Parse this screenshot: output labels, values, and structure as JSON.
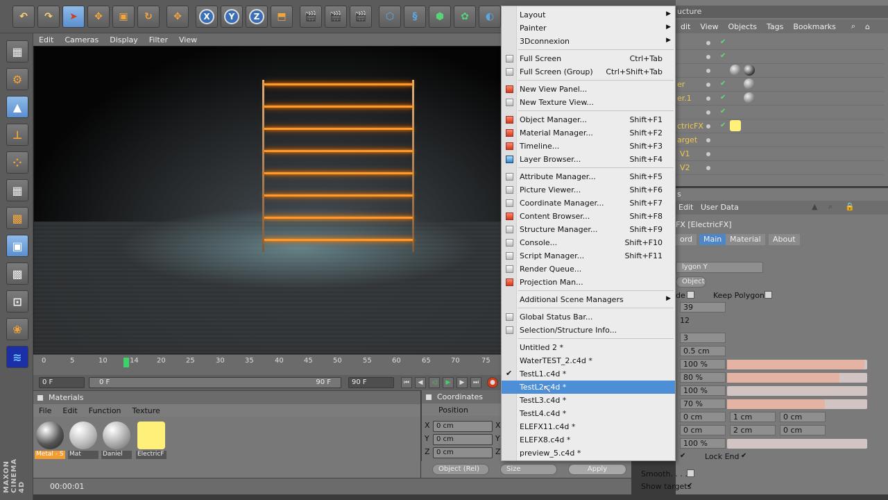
{
  "toolbar": {
    "axis_x": "X",
    "axis_y": "Y",
    "axis_z": "Z"
  },
  "viewport": {
    "menu": [
      "Edit",
      "Cameras",
      "Display",
      "Filter",
      "View"
    ]
  },
  "timeline": {
    "ticks": [
      "0",
      "5",
      "10",
      "14",
      "20",
      "25",
      "30",
      "35",
      "40",
      "45",
      "50",
      "55",
      "60",
      "65",
      "70",
      "75"
    ],
    "start_field": "0 F",
    "range_start": "0 F",
    "range_end": "90 F",
    "end_field": "90 F"
  },
  "materials": {
    "title": "Materials",
    "menu": [
      "File",
      "Edit",
      "Function",
      "Texture"
    ],
    "items": [
      "Metal - S",
      "Mat",
      "Daniel",
      "ElectricF"
    ]
  },
  "coordinates": {
    "title": "Coordinates",
    "position_label": "Position",
    "rows": [
      {
        "axis": "X",
        "value": "0 cm",
        "axis2": "X"
      },
      {
        "axis": "Y",
        "value": "0 cm",
        "axis2": "Y"
      },
      {
        "axis": "Z",
        "value": "0 cm",
        "axis2": "Z"
      }
    ],
    "mode_dropdown": "Object (Rel)",
    "size_dropdown": "Size",
    "apply_label": "Apply"
  },
  "status": {
    "time": "00:00:01"
  },
  "object_manager": {
    "tab_label": "ucture",
    "menu": [
      "dit",
      "View",
      "Objects",
      "Tags",
      "Bookmarks"
    ],
    "rows": [
      {
        "name": ""
      },
      {
        "name": ""
      },
      {
        "name": ""
      },
      {
        "name": "er"
      },
      {
        "name": "er.1"
      },
      {
        "name": ""
      },
      {
        "name": "ctricFX"
      },
      {
        "name": "arget"
      },
      {
        "name": "V1"
      },
      {
        "name": "V2"
      }
    ]
  },
  "attribute_manager": {
    "header_fragment": "s",
    "menu": [
      "Edit",
      "User Data"
    ],
    "object_title": "FX [ElectricFX]",
    "tabs": [
      "ord",
      "Main",
      "Material",
      "About"
    ],
    "dropdown1": "lygon Y",
    "button1": "Object",
    "mode_fragment": "de",
    "keep_polygon_label": "Keep Polygon",
    "value_39": "39",
    "value_12": "12",
    "value_3": "3",
    "value_05cm": "0.5 cm",
    "pct_rows": [
      {
        "value": "100 %",
        "fill": 1.0
      },
      {
        "value": "80 %",
        "fill": 0.8
      },
      {
        "value": "100 %",
        "fill": 0.0
      },
      {
        "value": "70 %",
        "fill": 0.7
      }
    ],
    "vec_row1": [
      "0 cm",
      "1 cm",
      "0 cm"
    ],
    "vec_row2": [
      "0 cm",
      "2 cm",
      "0 cm"
    ],
    "pct_last": "100 %",
    "lock_end_label": "Lock End",
    "smooth_label": "Smooth. . . . .",
    "show_targets_label": "Show targets"
  },
  "window_menu": {
    "items": [
      {
        "label": "Layout",
        "shortcut": "",
        "submenu": true
      },
      {
        "label": "Painter",
        "shortcut": "",
        "submenu": true
      },
      {
        "label": "3Dconnexion",
        "shortcut": "",
        "submenu": true
      },
      {
        "label": "Full Screen",
        "shortcut": "Ctrl+Tab"
      },
      {
        "label": "Full Screen (Group)",
        "shortcut": "Ctrl+Shift+Tab"
      },
      {
        "label": "New View Panel...",
        "shortcut": ""
      },
      {
        "label": "New Texture View...",
        "shortcut": ""
      },
      {
        "label": "Object Manager...",
        "shortcut": "Shift+F1"
      },
      {
        "label": "Material Manager...",
        "shortcut": "Shift+F2"
      },
      {
        "label": "Timeline...",
        "shortcut": "Shift+F3"
      },
      {
        "label": "Layer Browser...",
        "shortcut": "Shift+F4"
      },
      {
        "label": "Attribute Manager...",
        "shortcut": "Shift+F5"
      },
      {
        "label": "Picture Viewer...",
        "shortcut": "Shift+F6"
      },
      {
        "label": "Coordinate Manager...",
        "shortcut": "Shift+F7"
      },
      {
        "label": "Content Browser...",
        "shortcut": "Shift+F8"
      },
      {
        "label": "Structure Manager...",
        "shortcut": "Shift+F9"
      },
      {
        "label": "Console...",
        "shortcut": "Shift+F10"
      },
      {
        "label": "Script Manager...",
        "shortcut": "Shift+F11"
      },
      {
        "label": "Render Queue...",
        "shortcut": ""
      },
      {
        "label": "Projection Man...",
        "shortcut": ""
      },
      {
        "label": "Additional Scene Managers",
        "shortcut": "",
        "submenu": true
      },
      {
        "label": "Global Status Bar...",
        "shortcut": ""
      },
      {
        "label": "Selection/Structure Info...",
        "shortcut": ""
      },
      {
        "label": "Untitled 2 *",
        "shortcut": ""
      },
      {
        "label": "WaterTEST_2.c4d *",
        "shortcut": ""
      },
      {
        "label": "TestL1.c4d *",
        "shortcut": "",
        "checked": true
      },
      {
        "label": "TestL2.c4d *",
        "shortcut": "",
        "highlighted": true
      },
      {
        "label": "TestL3.c4d *",
        "shortcut": ""
      },
      {
        "label": "TestL4.c4d *",
        "shortcut": ""
      },
      {
        "label": "ELEFX11.c4d *",
        "shortcut": ""
      },
      {
        "label": "ELEFX8.c4d *",
        "shortcut": ""
      },
      {
        "label": "preview_5.c4d *",
        "shortcut": ""
      }
    ]
  },
  "branding": {
    "logo": "MAXON CINEMA 4D"
  },
  "colors": {
    "accent": "#4d8fd6",
    "rung_glow": "#ff9a2a",
    "selection_orange": "#f39c32"
  }
}
